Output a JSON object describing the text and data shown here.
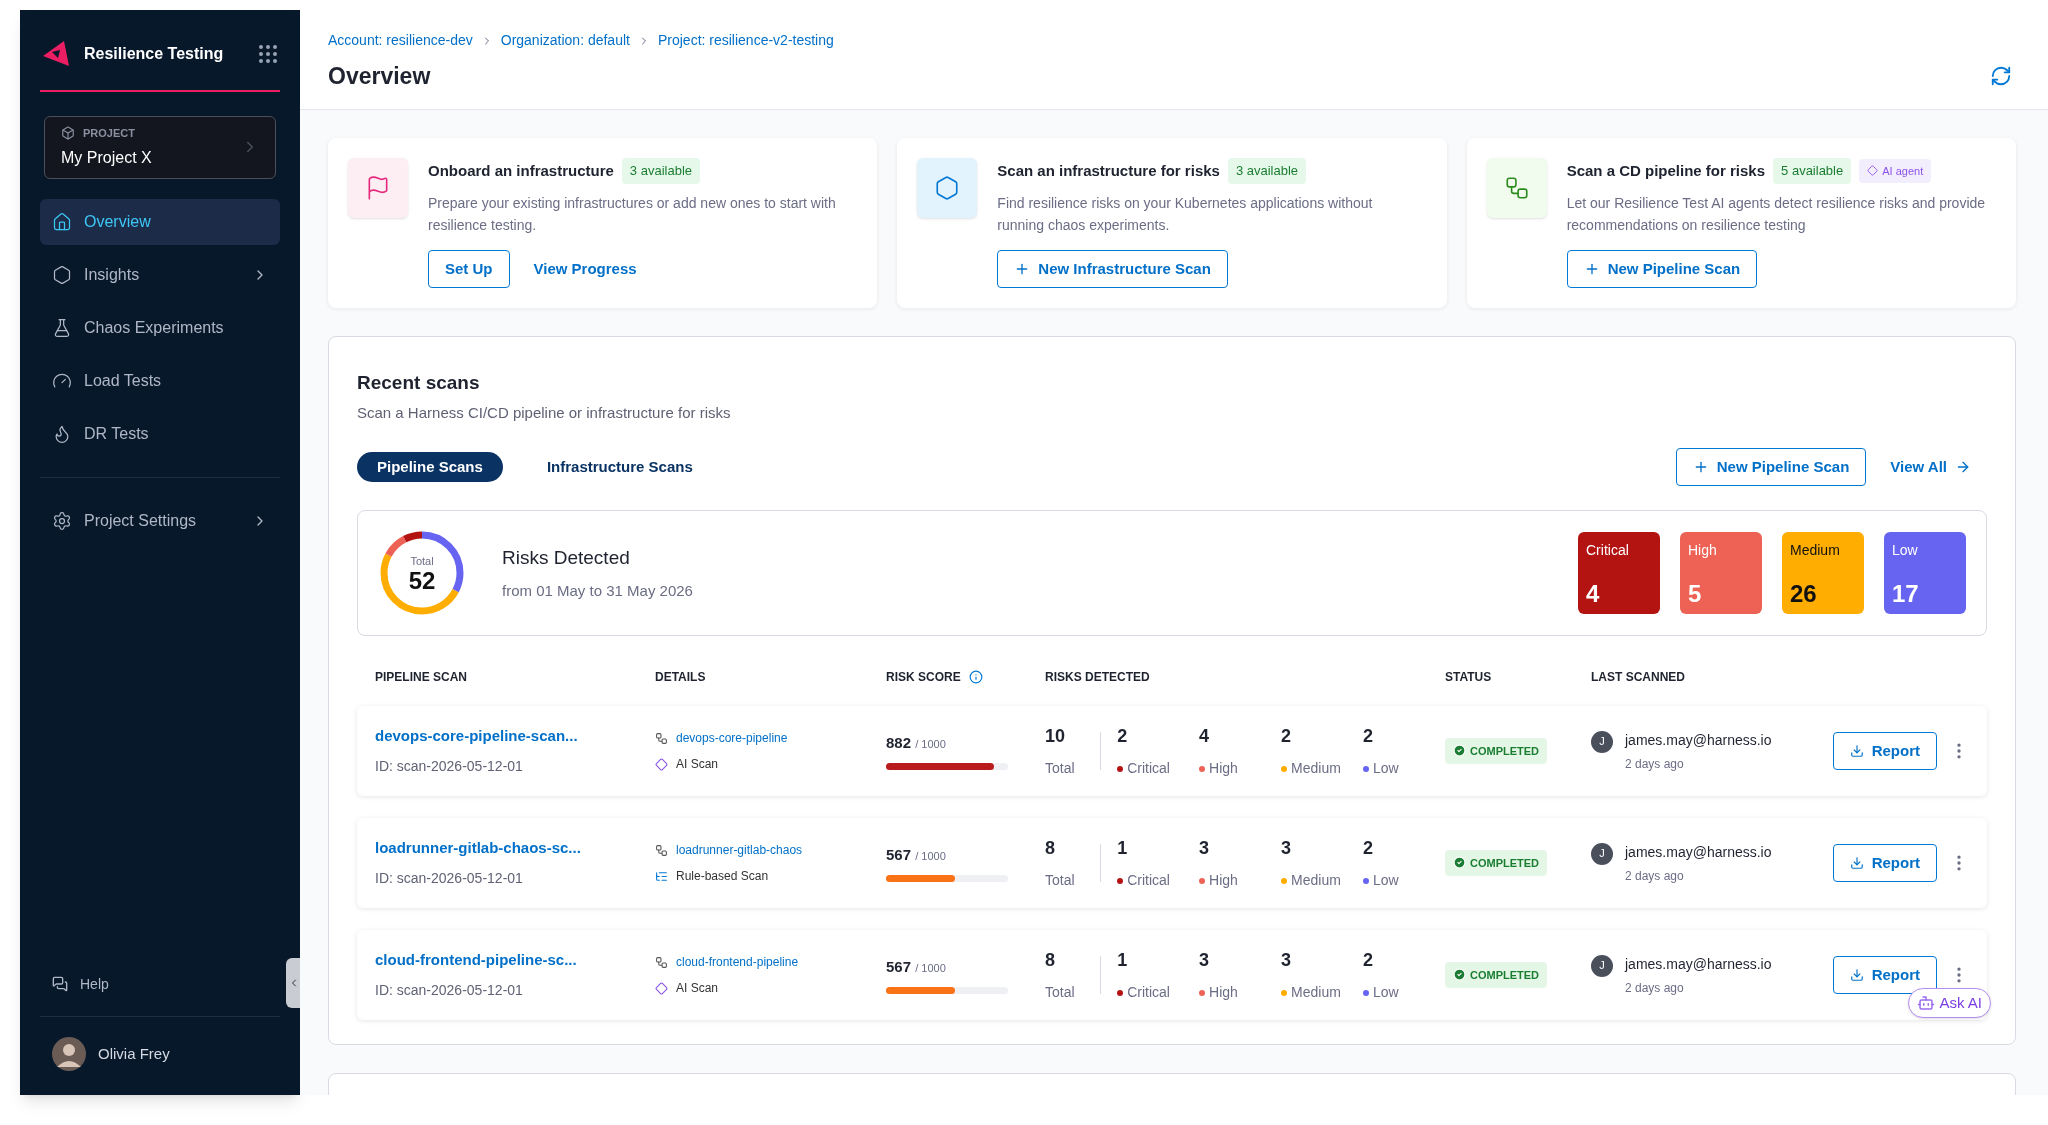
{
  "sidebar": {
    "title": "Resilience Testing",
    "project": {
      "label": "PROJECT",
      "name": "My Project X"
    },
    "nav": [
      {
        "label": "Overview",
        "selected": true,
        "expandable": false
      },
      {
        "label": "Insights",
        "selected": false,
        "expandable": true
      },
      {
        "label": "Chaos Experiments",
        "selected": false,
        "expandable": false
      },
      {
        "label": "Load Tests",
        "selected": false,
        "expandable": false
      },
      {
        "label": "DR Tests",
        "selected": false,
        "expandable": false
      }
    ],
    "settings": {
      "label": "Project Settings",
      "selected": false,
      "expandable": true
    },
    "help": "Help",
    "user": "Olivia Frey"
  },
  "breadcrumbs": [
    "Account: resilience-dev",
    "Organization: default",
    "Project: resilience-v2-testing"
  ],
  "page_title": "Overview",
  "cards": [
    {
      "title": "Onboard an infrastructure",
      "badge": "3 available",
      "description": "Prepare your existing infrastructures or add new ones to start with resilience testing.",
      "buttons": [
        {
          "label": "Set Up",
          "kind": "outline",
          "plus": false
        },
        {
          "label": "View Progress",
          "kind": "link",
          "plus": false
        }
      ]
    },
    {
      "title": "Scan an infrastructure for risks",
      "badge": "3 available",
      "description": "Find resilience risks on your Kubernetes applications without running chaos experiments.",
      "buttons": [
        {
          "label": "New Infrastructure Scan",
          "kind": "outline",
          "plus": true
        }
      ]
    },
    {
      "title": "Scan a CD pipeline for risks",
      "badge": "5 available",
      "ai_badge": "AI agent",
      "description": "Let our Resilience Test AI agents detect resilience risks and provide recommendations on resilience testing",
      "buttons": [
        {
          "label": "New Pipeline Scan",
          "kind": "outline",
          "plus": true
        }
      ]
    }
  ],
  "recent_scans": {
    "title": "Recent scans",
    "subtitle": "Scan a Harness CI/CD pipeline or infrastructure for risks",
    "tabs": [
      {
        "label": "Pipeline Scans",
        "selected": true
      },
      {
        "label": "Infrastructure Scans",
        "selected": false
      }
    ],
    "new_button": "New Pipeline Scan",
    "view_all": "View All",
    "summary": {
      "total_label": "Total",
      "total": "52",
      "title": "Risks Detected",
      "range": "from 01 May to 31 May 2026",
      "levels": [
        {
          "label": "Critical",
          "count": "4",
          "color": "#b31412"
        },
        {
          "label": "High",
          "count": "5",
          "color": "#ee6255"
        },
        {
          "label": "Medium",
          "count": "26",
          "color": "#ffad00"
        },
        {
          "label": "Low",
          "count": "17",
          "color": "#6764f1"
        }
      ]
    },
    "columns": [
      "PIPELINE SCAN",
      "DETAILS",
      "RISK SCORE",
      "RISKS DETECTED",
      "STATUS",
      "LAST SCANNED"
    ],
    "rows": [
      {
        "name": "devops-core-pipeline-scan...",
        "id": "ID: scan-2026-05-12-01",
        "pipeline": "devops-core-pipeline",
        "scan_type": "AI Scan",
        "kind": "ai",
        "score": "882",
        "score_max": "/ 1000",
        "level": 0.882,
        "color": "#b91c1c",
        "total": "10",
        "total_label": "Total",
        "risks": [
          {
            "count": "2",
            "label": "Critical",
            "color": "#b31412"
          },
          {
            "count": "4",
            "label": "High",
            "color": "#ee6255"
          },
          {
            "count": "2",
            "label": "Medium",
            "color": "#ffad00"
          },
          {
            "count": "2",
            "label": "Low",
            "color": "#6764f1"
          }
        ],
        "status": "COMPLETED",
        "user_initial": "J",
        "user": "james.may@harness.io",
        "time": "2 days ago",
        "report": "Report"
      },
      {
        "name": "loadrunner-gitlab-chaos-sc...",
        "id": "ID: scan-2026-05-12-01",
        "pipeline": "loadrunner-gitlab-chaos",
        "scan_type": "Rule-based Scan",
        "kind": "rule",
        "score": "567",
        "score_max": "/ 1000",
        "level": 0.567,
        "color": "#f97316",
        "total": "8",
        "total_label": "Total",
        "risks": [
          {
            "count": "1",
            "label": "Critical",
            "color": "#b31412"
          },
          {
            "count": "3",
            "label": "High",
            "color": "#ee6255"
          },
          {
            "count": "3",
            "label": "Medium",
            "color": "#ffad00"
          },
          {
            "count": "2",
            "label": "Low",
            "color": "#6764f1"
          }
        ],
        "status": "COMPLETED",
        "user_initial": "J",
        "user": "james.may@harness.io",
        "time": "2 days ago",
        "report": "Report"
      },
      {
        "name": "cloud-frontend-pipeline-sc...",
        "id": "ID: scan-2026-05-12-01",
        "pipeline": "cloud-frontend-pipeline",
        "scan_type": "AI Scan",
        "kind": "ai",
        "score": "567",
        "score_max": "/ 1000",
        "level": 0.567,
        "color": "#f97316",
        "total": "8",
        "total_label": "Total",
        "risks": [
          {
            "count": "1",
            "label": "Critical",
            "color": "#b31412"
          },
          {
            "count": "3",
            "label": "High",
            "color": "#ee6255"
          },
          {
            "count": "3",
            "label": "Medium",
            "color": "#ffad00"
          },
          {
            "count": "2",
            "label": "Low",
            "color": "#6764f1"
          }
        ],
        "status": "COMPLETED",
        "user_initial": "J",
        "user": "james.may@harness.io",
        "time": "2 days ago",
        "report": "Report"
      }
    ]
  },
  "ask_ai": "Ask AI"
}
